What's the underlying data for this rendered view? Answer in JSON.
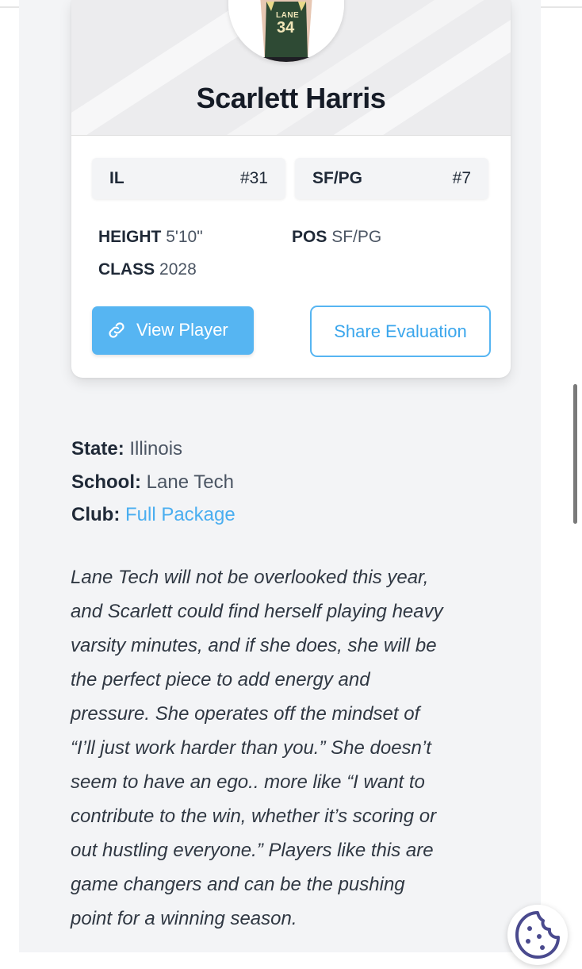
{
  "player": {
    "name": "Scarlett Harris",
    "jersey_team_text": "LANE",
    "jersey_number": "34"
  },
  "badges": [
    {
      "label": "IL",
      "rank": "#31"
    },
    {
      "label": "SF/PG",
      "rank": "#7"
    }
  ],
  "stats": {
    "height_label": "HEIGHT",
    "height_value": "5'10\"",
    "pos_label": "POS",
    "pos_value": "SF/PG",
    "class_label": "CLASS",
    "class_value": "2028"
  },
  "actions": {
    "view_player": "View Player",
    "share_evaluation": "Share Evaluation"
  },
  "details": {
    "state_label": "State:",
    "state_value": "Illinois",
    "school_label": "School:",
    "school_value": "Lane Tech",
    "club_label": "Club:",
    "club_value": "Full Package"
  },
  "evaluation_lines": [
    "Lane Tech will not be overlooked this year,",
    "and Scarlett could find herself playing heavy",
    "varsity minutes, and if she does, she will be",
    "the perfect piece to add energy and",
    "pressure. She operates off the mindset of",
    "“I’ll just work harder than you.” She doesn’t",
    "seem to have an ego.. more like “I want to",
    "contribute to the win, whether it’s scoring or",
    "out hustling everyone.” Players like this are",
    "game changers and can be the pushing",
    "point for a winning season."
  ],
  "colors": {
    "accent": "#56b5f2",
    "jersey_green": "#2e4a34",
    "cookie_purple": "#4a4a8e"
  },
  "icons": {
    "view_player": "link-icon",
    "cookie": "cookie-icon"
  }
}
